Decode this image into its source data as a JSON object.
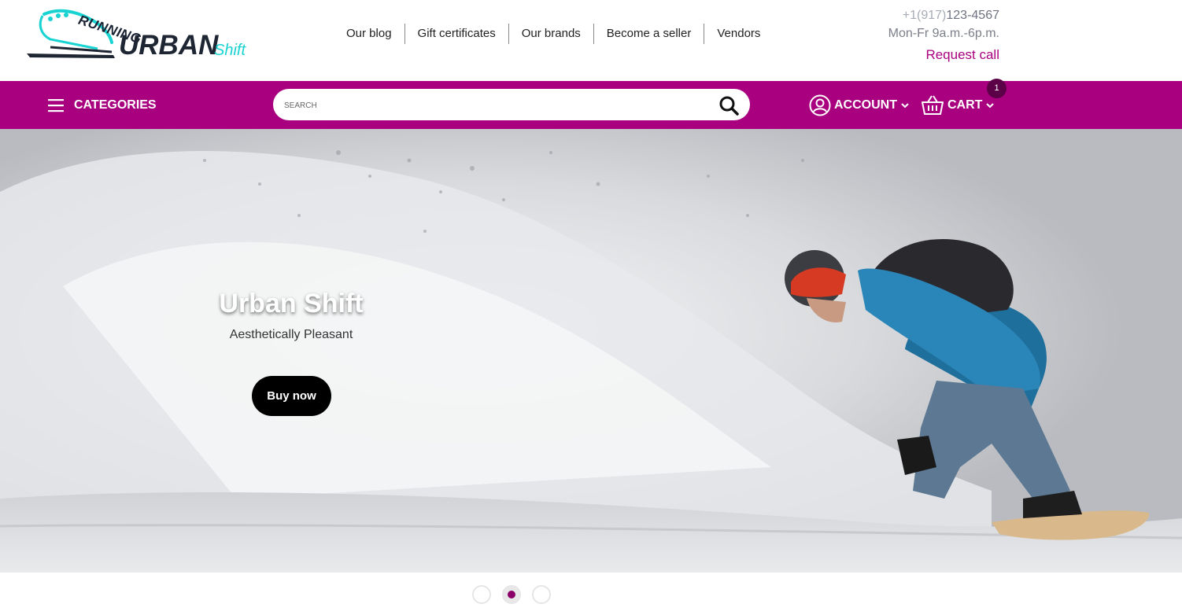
{
  "brand": {
    "logo_top": "RUNNING",
    "logo_main": "URBAN",
    "logo_accent": "Shift",
    "logo_colors": {
      "dark": "#1f2633",
      "accent": "#19d3d3"
    }
  },
  "top_nav": {
    "items": [
      {
        "label": "Our blog"
      },
      {
        "label": "Gift certificates"
      },
      {
        "label": "Our brands"
      },
      {
        "label": "Become a seller"
      },
      {
        "label": "Vendors"
      }
    ]
  },
  "contact": {
    "phone_code": "+1(917)",
    "phone_number": "123-4567",
    "hours": "Mon-Fr 9a.m.-6p.m.",
    "request_call": "Request call"
  },
  "toolbar": {
    "color": "#a8007f",
    "categories_label": "CATEGORIES",
    "search_placeholder": "SEARCH",
    "account_label": "ACCOUNT",
    "cart_label": "CART",
    "cart_count": "1"
  },
  "hero": {
    "title": "Urban Shift",
    "subtitle": "Aesthetically Pleasant",
    "button_label": "Buy now",
    "image_description_icon": "snowboarder-photo"
  },
  "slider": {
    "dot_count": 3,
    "active_index": 1,
    "active_color": "#8b0069"
  }
}
